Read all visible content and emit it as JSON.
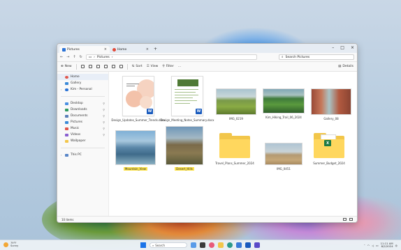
{
  "tabs": [
    {
      "label": "Pictures",
      "active": true
    },
    {
      "label": "Home",
      "active": false
    }
  ],
  "address": {
    "path": "Pictures"
  },
  "search": {
    "placeholder": "Search Pictures"
  },
  "toolbar": {
    "new_label": "New",
    "sort_label": "Sort",
    "view_label": "View",
    "filter_label": "Filter",
    "more_label": "...",
    "details_label": "Details"
  },
  "sidebar": {
    "top_items": [
      {
        "label": "Home",
        "icon": "home-icon"
      },
      {
        "label": "Gallery",
        "icon": "gallery-icon"
      },
      {
        "label": "Kim - Personal",
        "icon": "cloud-icon"
      }
    ],
    "quick_items": [
      {
        "label": "Desktop",
        "icon": "desktop-icon",
        "color": "#4a90e2"
      },
      {
        "label": "Downloads",
        "icon": "downloads-icon",
        "color": "#2f9a5e"
      },
      {
        "label": "Documents",
        "icon": "documents-icon",
        "color": "#5a7fb8"
      },
      {
        "label": "Pictures",
        "icon": "pictures-icon",
        "color": "#3a8ad8"
      },
      {
        "label": "Music",
        "icon": "music-icon",
        "color": "#e0554a"
      },
      {
        "label": "Videos",
        "icon": "videos-icon",
        "color": "#8a5fd0"
      },
      {
        "label": "Wallpaper",
        "icon": "folder-icon",
        "color": "#f2c64a"
      }
    ],
    "bottom_items": [
      {
        "label": "This PC",
        "icon": "pc-icon"
      }
    ]
  },
  "files": [
    {
      "name": "Design_Updates_Summer_Trends.docx",
      "kind": "doc1",
      "highlight": false
    },
    {
      "name": "Design_Meeting_Notes_Summary.docx",
      "kind": "doc2",
      "highlight": false
    },
    {
      "name": "IMG_0219",
      "kind": "p1",
      "highlight": false
    },
    {
      "name": "Kim_Hiking_Trail_06_2024",
      "kind": "p2",
      "highlight": false
    },
    {
      "name": "Gallery_08",
      "kind": "p3",
      "highlight": false
    },
    {
      "name": "Mountain_View",
      "kind": "p4",
      "highlight": true
    },
    {
      "name": "Desert_Hills",
      "kind": "p5",
      "highlight": true
    },
    {
      "name": "Travel_Plans_Summer_2024",
      "kind": "folder",
      "highlight": false
    },
    {
      "name": "IMG_0451",
      "kind": "p6",
      "highlight": false
    },
    {
      "name": "Summer_Budget_2024",
      "kind": "folderxl",
      "highlight": false
    }
  ],
  "status": {
    "count": "10 items"
  },
  "taskbar": {
    "weather_temp": "79°F",
    "weather_desc": "Sunny",
    "search_label": "Search",
    "time": "11:11 AM",
    "date": "8/2/2024"
  }
}
